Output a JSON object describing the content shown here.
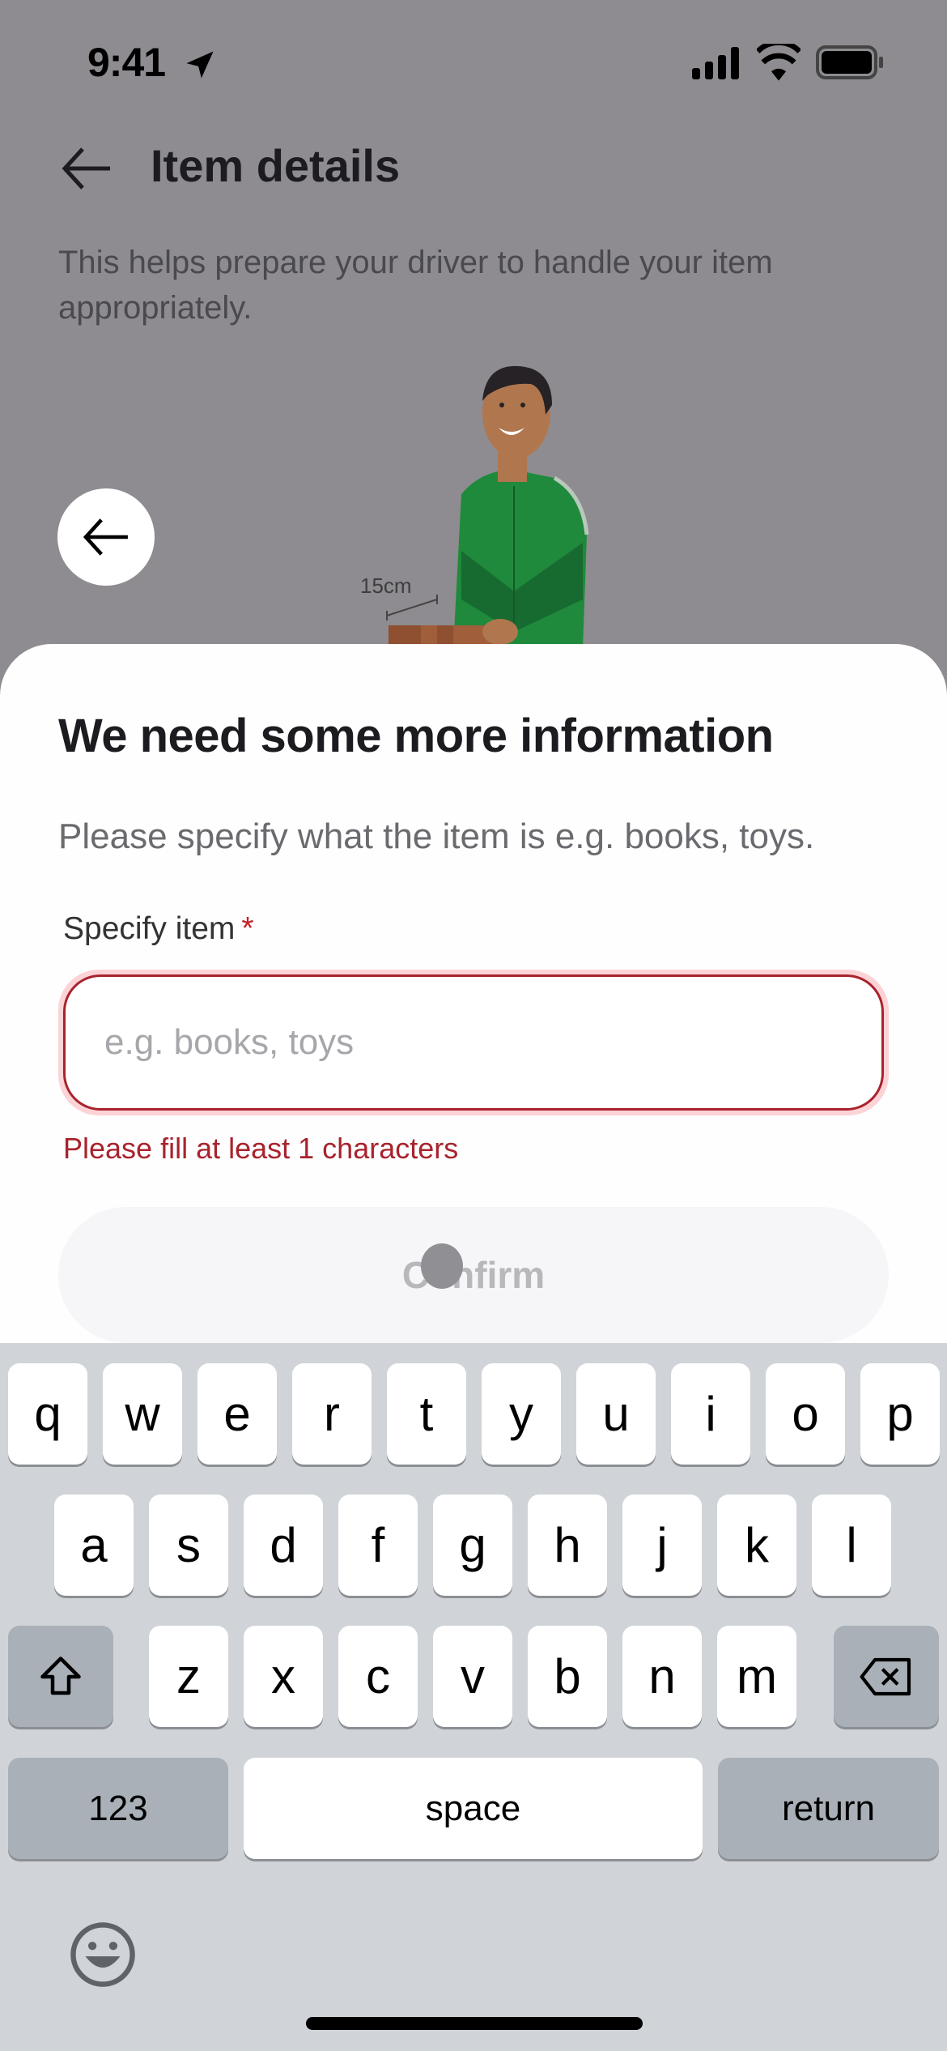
{
  "status_bar": {
    "time": "9:41"
  },
  "header": {
    "title": "Item details",
    "subtitle": "This helps prepare your driver to handle your item appropriately."
  },
  "illustration": {
    "dimension_label": "15cm"
  },
  "sheet": {
    "title": "We need some more information",
    "description": "Please specify what the item is e.g. books, toys.",
    "field": {
      "label": "Specify item",
      "required_marker": "*",
      "value": "",
      "placeholder": "e.g. books, toys",
      "error": "Please fill at least 1 characters"
    },
    "confirm_label": "Confirm"
  },
  "colors": {
    "error": "#a8232d",
    "jacket": "#1f8a3c",
    "scrim": "#8e8c90"
  },
  "keyboard": {
    "row1": [
      "q",
      "w",
      "e",
      "r",
      "t",
      "y",
      "u",
      "i",
      "o",
      "p"
    ],
    "row2": [
      "a",
      "s",
      "d",
      "f",
      "g",
      "h",
      "j",
      "k",
      "l"
    ],
    "row3": [
      "z",
      "x",
      "c",
      "v",
      "b",
      "n",
      "m"
    ],
    "numbers_label": "123",
    "space_label": "space",
    "return_label": "return"
  }
}
